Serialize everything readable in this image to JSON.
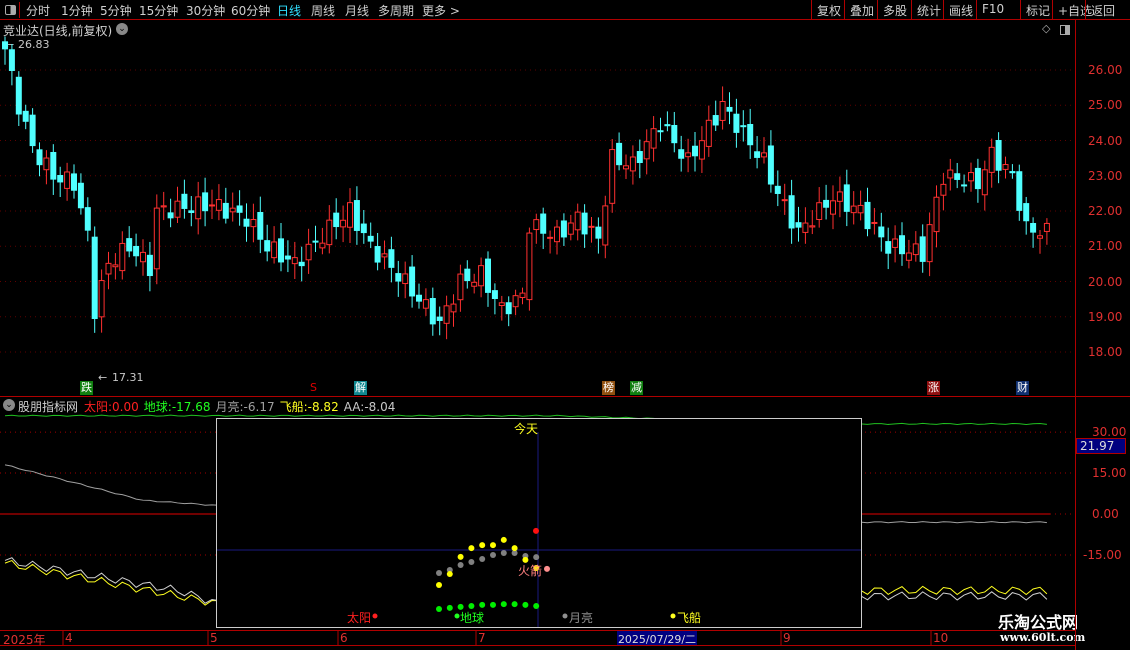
{
  "toolbar": {
    "periods": [
      "分时",
      "1分钟",
      "5分钟",
      "15分钟",
      "30分钟",
      "60分钟",
      "日线",
      "周线",
      "月线",
      "多周期",
      "更多 >"
    ],
    "active_period": "日线",
    "right_buttons": [
      "复权",
      "叠加",
      "多股",
      "统计",
      "画线",
      "F10",
      "标记",
      "+自选",
      "返回"
    ]
  },
  "main_chart": {
    "title": "竞业达(日线,前复权)",
    "high_label": "26.83",
    "low_label": "17.31",
    "price_axis": [
      "26.00",
      "25.00",
      "24.00",
      "23.00",
      "22.00",
      "21.00",
      "20.00",
      "19.00",
      "18.00"
    ],
    "signals": [
      {
        "text": "跌",
        "color": "#108010"
      },
      {
        "text": "S",
        "color": "#e00000"
      },
      {
        "text": "解",
        "color": "#108890"
      },
      {
        "text": "榜",
        "color": "#905010"
      },
      {
        "text": "减",
        "color": "#108010"
      },
      {
        "text": "涨",
        "color": "#901010"
      },
      {
        "text": "财",
        "color": "#103070"
      }
    ]
  },
  "indicator": {
    "name": "股朋指标网",
    "values": [
      {
        "label": "太阳:",
        "value": "0.00",
        "color": "#ff2020"
      },
      {
        "label": "地球:",
        "value": "-17.68",
        "color": "#20ff20"
      },
      {
        "label": "月亮:",
        "value": "-6.17",
        "color": "#a0a0a0"
      },
      {
        "label": "飞船:",
        "value": "-8.82",
        "color": "#ffff20"
      },
      {
        "label": "AA:",
        "value": "-8.04",
        "color": "#c8c8c8"
      }
    ],
    "axis": [
      "30.00",
      "15.00",
      "0.00",
      "-15.00"
    ],
    "current_value": "21.97"
  },
  "overlay": {
    "today_label": "今天",
    "rocket_label": "火箭",
    "legend": [
      {
        "text": "太阳",
        "color": "#ff2020"
      },
      {
        "text": "地球",
        "color": "#20ff20"
      },
      {
        "text": "月亮",
        "color": "#909090"
      },
      {
        "text": "飞船",
        "color": "#ffff20"
      }
    ]
  },
  "time_axis": {
    "labels": [
      "2025年",
      "4",
      "5",
      "6",
      "7",
      "9",
      "10"
    ],
    "cursor_date": "2025/07/29/二"
  },
  "watermark": {
    "title": "乐淘公式网",
    "url": "www.60lt.com"
  },
  "chart_data": {
    "type": "candlestick",
    "price_keypoints": [
      [
        0,
        26.6
      ],
      [
        2,
        25
      ],
      [
        4,
        23.8
      ],
      [
        7,
        23
      ],
      [
        10,
        22.8
      ],
      [
        12,
        21.3
      ],
      [
        13,
        19.2
      ],
      [
        15,
        20.5
      ],
      [
        18,
        21
      ],
      [
        21,
        20.4
      ],
      [
        22,
        22
      ],
      [
        30,
        22.2
      ],
      [
        35,
        21.8
      ],
      [
        38,
        21
      ],
      [
        42,
        20.5
      ],
      [
        47,
        21.5
      ],
      [
        50,
        22
      ],
      [
        53,
        21
      ],
      [
        57,
        20.2
      ],
      [
        63,
        18.8
      ],
      [
        66,
        20
      ],
      [
        69,
        20.2
      ],
      [
        72,
        19.2
      ],
      [
        75,
        19.6
      ],
      [
        76,
        21.6
      ],
      [
        80,
        21.3
      ],
      [
        83,
        21.8
      ],
      [
        86,
        21.2
      ],
      [
        88,
        23.5
      ],
      [
        91,
        23.3
      ],
      [
        95,
        24.5
      ],
      [
        99,
        23.4
      ],
      [
        104,
        25
      ],
      [
        110,
        23.4
      ],
      [
        112,
        22.5
      ],
      [
        115,
        21.4
      ],
      [
        120,
        22.4
      ],
      [
        124,
        22
      ],
      [
        128,
        21
      ],
      [
        133,
        20.8
      ],
      [
        136,
        23
      ],
      [
        141,
        22.8
      ],
      [
        143,
        23.6
      ],
      [
        146,
        23
      ],
      [
        148,
        21.5
      ],
      [
        151,
        21.4
      ]
    ],
    "price_range": [
      17,
      27
    ],
    "indicator_lines": {
      "green_upper": [
        [
          0,
          36
        ],
        [
          80,
          36
        ],
        [
          120,
          33
        ]
      ],
      "white_slow": [
        [
          0,
          18
        ],
        [
          20,
          5
        ],
        [
          60,
          -2
        ],
        [
          120,
          -3
        ]
      ],
      "yellow": [
        [
          0,
          -18
        ],
        [
          25,
          -30
        ],
        [
          40,
          -37
        ],
        [
          60,
          -31
        ],
        [
          110,
          -28
        ]
      ],
      "white": [
        [
          0,
          -17
        ],
        [
          25,
          -28
        ],
        [
          40,
          -40
        ],
        [
          60,
          -33
        ],
        [
          110,
          -30
        ]
      ]
    },
    "overlay_series": {
      "yellow": [
        -26,
        -22,
        -15.7,
        -12.5,
        -11.4,
        -11.4,
        -9.5,
        -12.5,
        -16.8,
        -19.8
      ],
      "gray": [
        -21.6,
        -20.5,
        -18.7,
        -17.6,
        -16.5,
        -15,
        -14.3,
        -14.3,
        -15.4,
        -15.8
      ],
      "green": [
        -34.8,
        -34.4,
        -34,
        -33.7,
        -33.3,
        -33.3,
        -33,
        -33,
        -33.3,
        -33.7
      ],
      "sun": -6.2,
      "rocket": -20.1
    }
  }
}
